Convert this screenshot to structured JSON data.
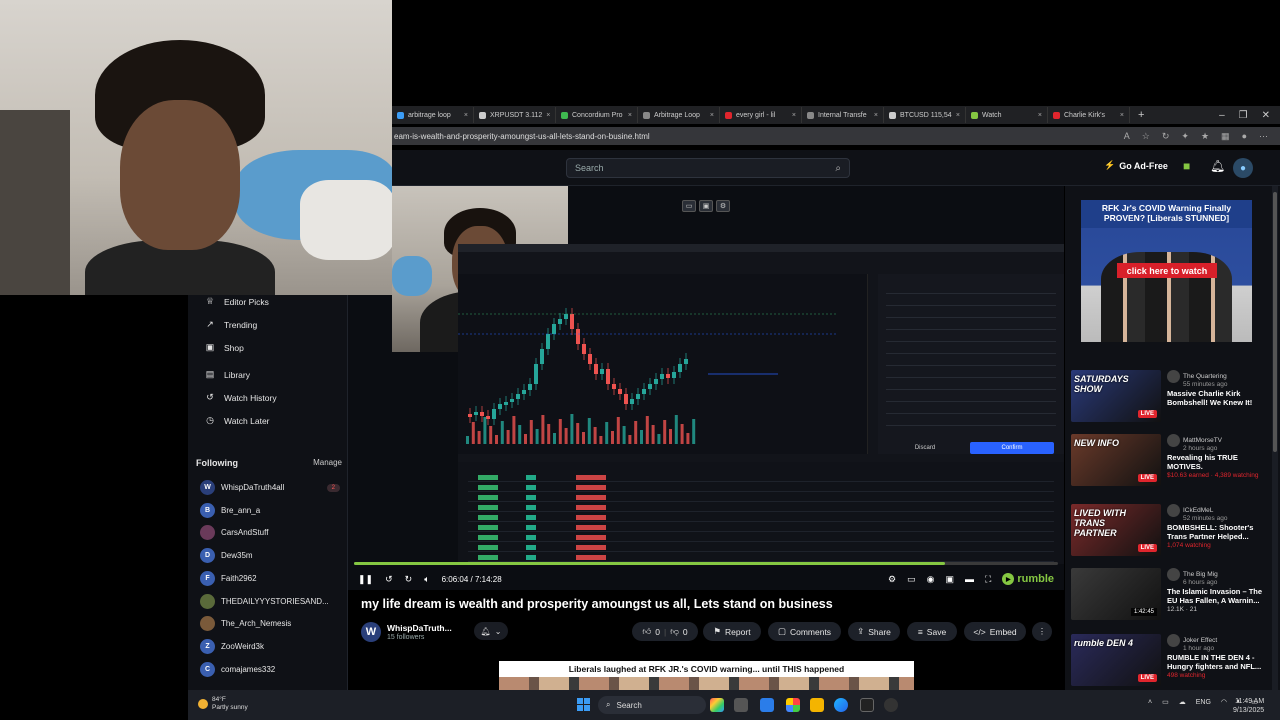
{
  "browser": {
    "tabs": [
      {
        "label": "arbitrage loop",
        "color": "#3b9cf5"
      },
      {
        "label": "XRPUSDT 3.112",
        "color": "#cccccc"
      },
      {
        "label": "Concordium Pro",
        "color": "#3fb950"
      },
      {
        "label": "Arbitrage Loop",
        "color": "#888888"
      },
      {
        "label": "every girl - lil",
        "color": "#e0252d"
      },
      {
        "label": "Internal Transfe",
        "color": "#888888"
      },
      {
        "label": "BTCUSD 115,54",
        "color": "#cccccc"
      },
      {
        "label": "Watch",
        "color": "#85c742"
      },
      {
        "label": "Charlie Kirk's",
        "color": "#e0252d"
      }
    ],
    "new_tab": "+",
    "url": "eam-is-wealth-and-prosperity-amoungst-us-all-lets-stand-on-busine.html"
  },
  "header": {
    "search_placeholder": "Search",
    "go_ad_free": "Go Ad-Free"
  },
  "sidebar": {
    "nav": [
      {
        "label": "Editor Picks",
        "icon": "trophy-icon",
        "glyph": "♕"
      },
      {
        "label": "Trending",
        "icon": "trending-icon",
        "glyph": "↗"
      },
      {
        "label": "Shop",
        "icon": "shop-icon",
        "glyph": "▣"
      },
      {
        "label": "Library",
        "icon": "library-icon",
        "glyph": "▤"
      },
      {
        "label": "Watch History",
        "icon": "history-icon",
        "glyph": "↺"
      },
      {
        "label": "Watch Later",
        "icon": "clock-icon",
        "glyph": "◷"
      }
    ],
    "following_title": "Following",
    "manage_label": "Manage",
    "following": [
      {
        "name": "WhispDaTruth4all",
        "initial": "W",
        "color": "#2a3f7a",
        "badge": "2"
      },
      {
        "name": "Bre_ann_a",
        "initial": "B",
        "color": "#3a5fb0",
        "badge": ""
      },
      {
        "name": "CarsAndStuff",
        "initial": "",
        "color": "#6a3a5a",
        "badge": ""
      },
      {
        "name": "Dew35m",
        "initial": "D",
        "color": "#3a5fb0",
        "badge": ""
      },
      {
        "name": "Faith2962",
        "initial": "F",
        "color": "#3a5fb0",
        "badge": ""
      },
      {
        "name": "THEDAILYYYSTORIESAND...",
        "initial": "",
        "color": "#5a6a3a",
        "badge": ""
      },
      {
        "name": "The_Arch_Nemesis",
        "initial": "",
        "color": "#7a5a3a",
        "badge": ""
      },
      {
        "name": "ZooWeird3k",
        "initial": "Z",
        "color": "#3a5fb0",
        "badge": ""
      },
      {
        "name": "comajames332",
        "initial": "C",
        "color": "#3a5fb0",
        "badge": ""
      }
    ]
  },
  "player": {
    "time": "6:06:04 / 7:14:28",
    "progress": 0.84,
    "brand": "rumble"
  },
  "video": {
    "title": "my life dream is wealth and prosperity amoungst us all, Lets stand on business",
    "channel_name": "WhispDaTruth...",
    "followers": "15 followers",
    "likes": "0",
    "dislikes": "0",
    "actions": [
      "Report",
      "Comments",
      "Share",
      "Save",
      "Embed"
    ]
  },
  "ad_banner": {
    "text": "Liberals laughed at RFK JR.'s COVID warning... until THIS happened"
  },
  "right_ad": {
    "title": "RFK Jr's COVID Warning Finally PROVEN? [Liberals STUNNED]",
    "button": "click here to watch"
  },
  "recommendations": [
    {
      "thumb_text": "SATURDAYS SHOW",
      "thumb_bg": "#2a3a7a",
      "channel": "The Quartering",
      "ago": "55 minutes ago",
      "title": "Massive Charlie Kirk Bombshell! We Knew It!",
      "stat": "",
      "tag": "LIVE"
    },
    {
      "thumb_text": "NEW INFO",
      "thumb_bg": "#6a3a2a",
      "channel": "MattMorseTV",
      "ago": "2 hours ago",
      "title": "Revealing his TRUE MOTIVES.",
      "stat": "$10.63 earned · 4,389 watching",
      "tag": "LIVE"
    },
    {
      "thumb_text": "LIVED WITH TRANS PARTNER",
      "thumb_bg": "#7a2a2a",
      "channel": "ICkEdMeL",
      "ago": "52 minutes ago",
      "title": "BOMBSHELL: Shooter's Trans Partner Helped...",
      "stat": "1,074 watching",
      "tag": "LIVE"
    },
    {
      "thumb_text": "",
      "thumb_bg": "#3a3a3a",
      "channel": "The Big Mig",
      "ago": "6 hours ago",
      "title": "The Islamic Invasion – The EU Has Fallen, A Warnin...",
      "stat": "12.1K · 21",
      "tag": "1:42:45"
    },
    {
      "thumb_text": "rumble DEN 4",
      "thumb_bg": "#2a2a5a",
      "channel": "Joker Effect",
      "ago": "1 hour ago",
      "title": "RUMBLE IN THE DEN 4 - Hungry fighters and NFL...",
      "stat": "498 watching",
      "tag": "LIVE"
    }
  ],
  "taskbar": {
    "weather_temp": "84°F",
    "weather_desc": "Partly sunny",
    "search": "Search",
    "lang": "ENG",
    "time": "11:49 AM",
    "date": "9/13/2025"
  }
}
